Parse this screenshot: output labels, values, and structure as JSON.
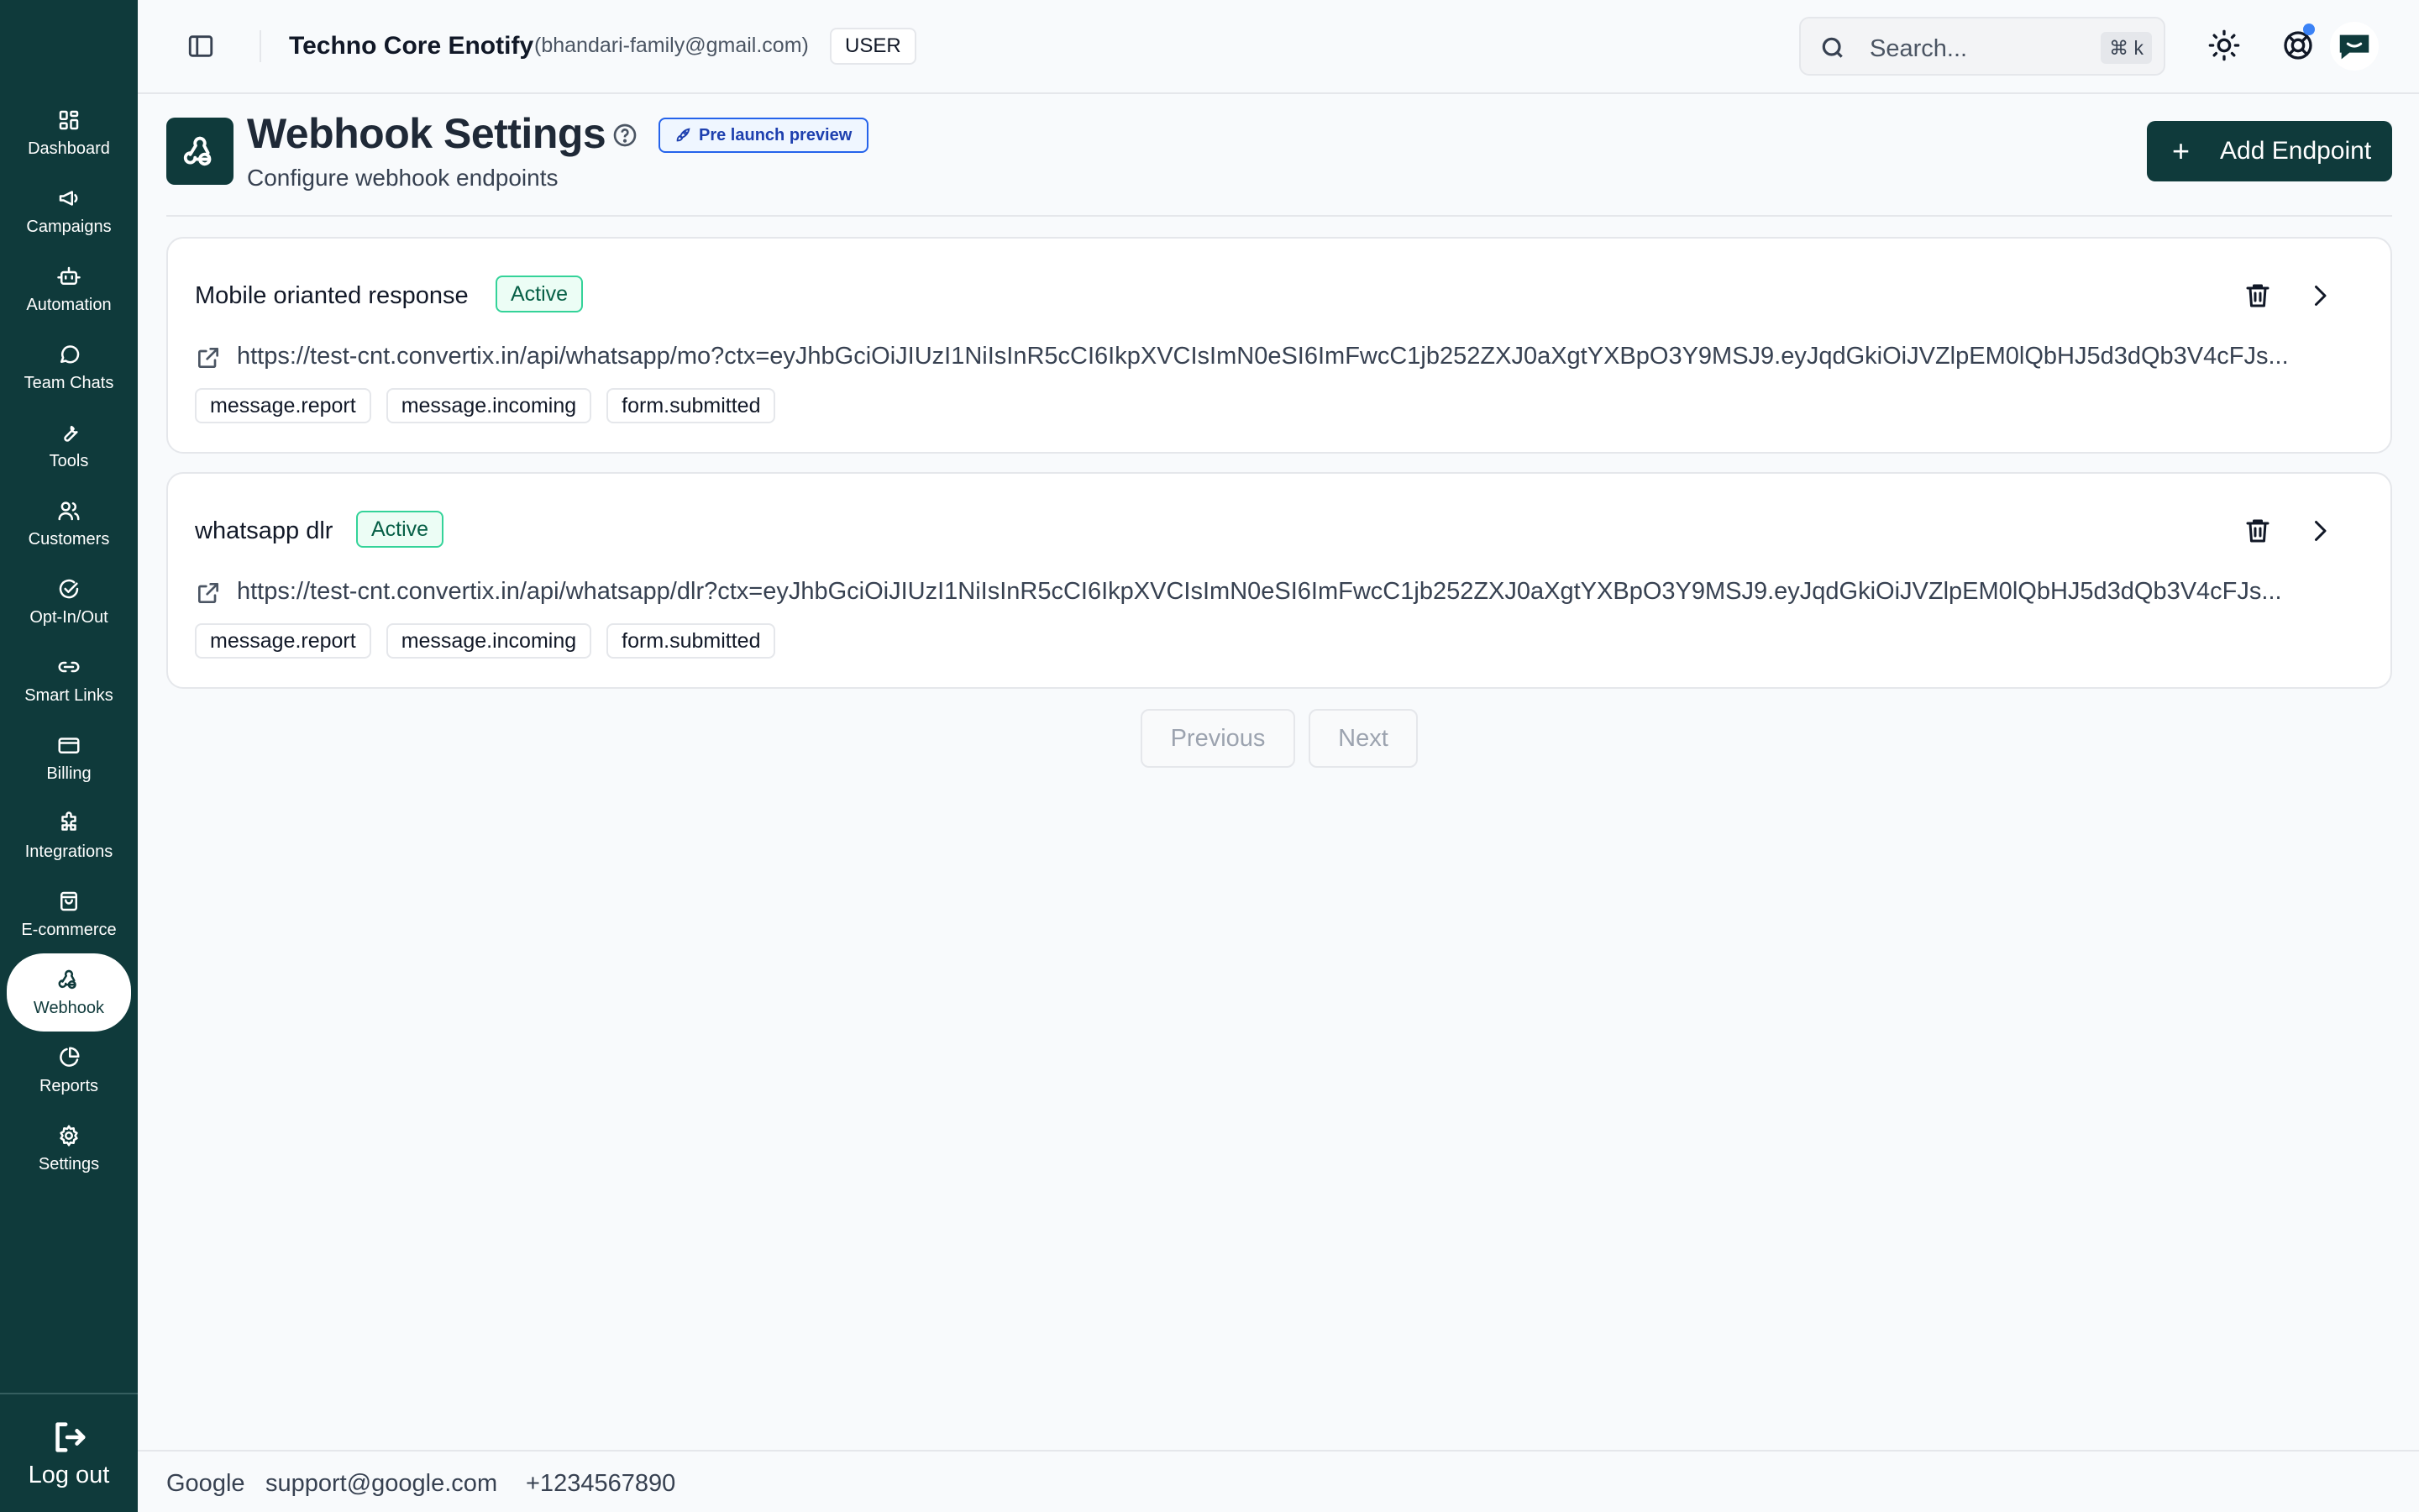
{
  "sidebar": {
    "items": [
      {
        "label": "Dashboard",
        "icon": "dashboard-icon"
      },
      {
        "label": "Campaigns",
        "icon": "megaphone-icon"
      },
      {
        "label": "Automation",
        "icon": "bot-icon"
      },
      {
        "label": "Team Chats",
        "icon": "chat-bubble-icon"
      },
      {
        "label": "Tools",
        "icon": "wrench-icon"
      },
      {
        "label": "Customers",
        "icon": "users-icon"
      },
      {
        "label": "Opt-In/Out",
        "icon": "check-circle-icon"
      },
      {
        "label": "Smart Links",
        "icon": "link-icon"
      },
      {
        "label": "Billing",
        "icon": "credit-card-icon"
      },
      {
        "label": "Integrations",
        "icon": "puzzle-icon"
      },
      {
        "label": "E-commerce",
        "icon": "shopping-bag-icon"
      },
      {
        "label": "Webhook",
        "icon": "webhook-icon",
        "active": true
      },
      {
        "label": "Reports",
        "icon": "pie-chart-icon"
      },
      {
        "label": "Settings",
        "icon": "gear-icon"
      }
    ],
    "logout_label": "Log out"
  },
  "header": {
    "org_name": "Techno Core Enotify",
    "email": "(bhandari-family@gmail.com)",
    "role": "USER",
    "search_placeholder": "Search...",
    "search_shortcut": "⌘ k"
  },
  "page": {
    "title": "Webhook Settings",
    "badge": "Pre launch preview",
    "subtitle": "Configure webhook endpoints",
    "add_button": "Add Endpoint"
  },
  "endpoints": [
    {
      "name": "Mobile orianted response",
      "status": "Active",
      "url": "https://test-cnt.convertix.in/api/whatsapp/mo?ctx=eyJhbGciOiJIUzI1NiIsInR5cCI6IkpXVCIsImN0eSI6ImFwcC1jb252ZXJ0aXgtYXBpO3Y9MSJ9.eyJqdGkiOiJVZlpEM0lQbHJ5d3dQb3V4cFJs...",
      "events": [
        "message.report",
        "message.incoming",
        "form.submitted"
      ]
    },
    {
      "name": "whatsapp dlr",
      "status": "Active",
      "url": "https://test-cnt.convertix.in/api/whatsapp/dlr?ctx=eyJhbGciOiJIUzI1NiIsInR5cCI6IkpXVCIsImN0eSI6ImFwcC1jb252ZXJ0aXgtYXBpO3Y9MSJ9.eyJqdGkiOiJVZlpEM0lQbHJ5d3dQb3V4cFJs...",
      "events": [
        "message.report",
        "message.incoming",
        "form.submitted"
      ]
    }
  ],
  "pagination": {
    "previous": "Previous",
    "next": "Next"
  },
  "footer": {
    "company": "Google",
    "email": "support@google.com",
    "phone": "+1234567890"
  },
  "colors": {
    "brand": "#0f3a3b",
    "active": "#34d399",
    "preview": "#2563eb",
    "notification": "#3b82f6"
  }
}
